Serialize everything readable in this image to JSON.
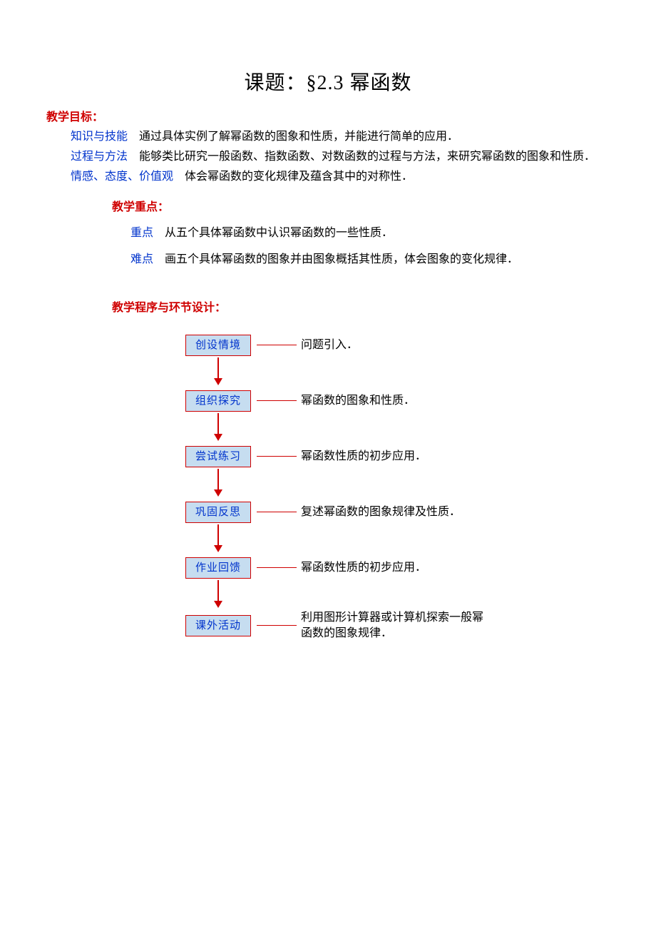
{
  "title": "课题：§2.3 幂函数",
  "goals": {
    "heading": "教学目标：",
    "items": [
      {
        "label": "知识与技能",
        "text": "通过具体实例了解幂函数的图象和性质，并能进行简单的应用．"
      },
      {
        "label": "过程与方法",
        "text": "能够类比研究一般函数、指数函数、对数函数的过程与方法，来研究幂函数的图象和性质．"
      },
      {
        "label": "情感、态度、价值观",
        "text": "体会幂函数的变化规律及蕴含其中的对称性．"
      }
    ]
  },
  "keypoints": {
    "heading": "教学重点：",
    "items": [
      {
        "label": "重点",
        "text": "从五个具体幂函数中认识幂函数的一些性质．"
      },
      {
        "label": "难点",
        "text": "画五个具体幂函数的图象并由图象概括其性质，体会图象的变化规律．"
      }
    ]
  },
  "procedure": {
    "heading": "教学程序与环节设计：",
    "steps": [
      {
        "box": "创设情境",
        "note": "问题引入．"
      },
      {
        "box": "组织探究",
        "note": "幂函数的图象和性质．"
      },
      {
        "box": "尝试练习",
        "note": "幂函数性质的初步应用．"
      },
      {
        "box": "巩固反思",
        "note": "复述幂函数的图象规律及性质．"
      },
      {
        "box": "作业回馈",
        "note": "幂函数性质的初步应用．"
      },
      {
        "box": "课外活动",
        "note": "利用图形计算器或计算机探索一般幂函数的图象规律．"
      }
    ]
  }
}
